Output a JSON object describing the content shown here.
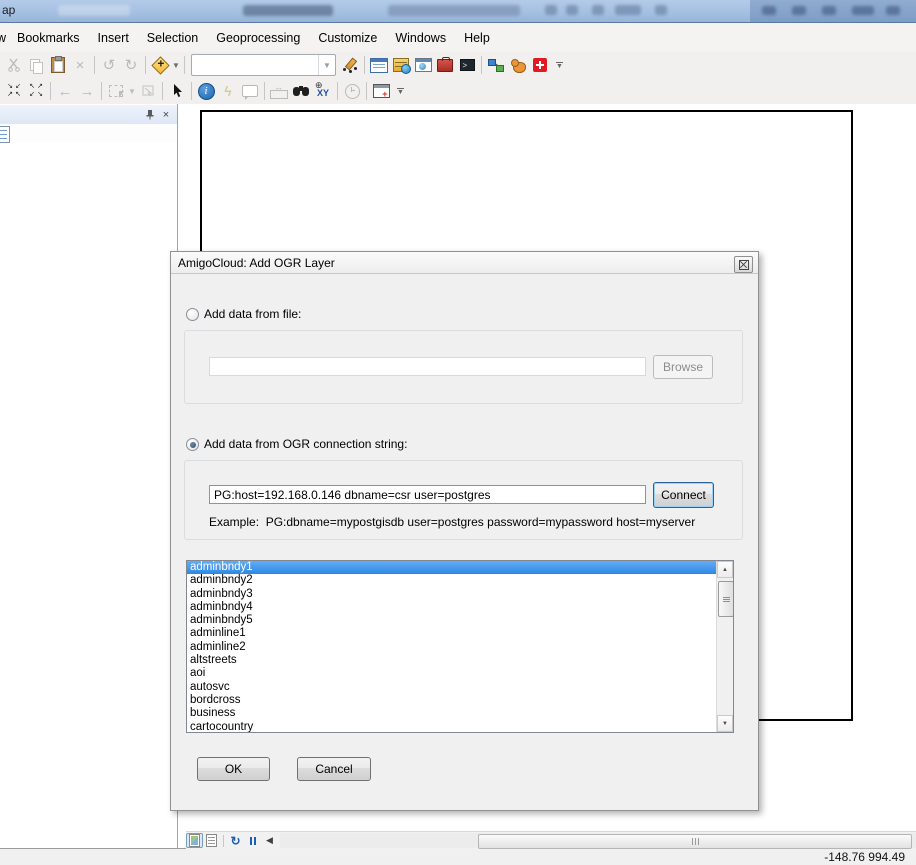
{
  "window": {
    "titlebar_fragment": "ap"
  },
  "menubar": {
    "items": [
      "w",
      "Bookmarks",
      "Insert",
      "Selection",
      "Geoprocessing",
      "Customize",
      "Windows",
      "Help"
    ]
  },
  "toolbars": {
    "standard_icons": [
      "cut",
      "copy",
      "paste",
      "delete",
      "undo",
      "redo",
      "add-data",
      "scale-combo",
      "edit-sketch",
      "table-of-contents",
      "catalog",
      "search-window",
      "arctoolbox",
      "python-window",
      "model-builder",
      "mascot",
      "amigocloud",
      "toolbar-overflow"
    ],
    "tools_icons": [
      "fixed-zoom-in",
      "fixed-zoom-out",
      "go-back",
      "go-forward",
      "select-features",
      "clear-selection",
      "select-elements",
      "identify",
      "hyperlink",
      "html-popup",
      "measure",
      "find",
      "go-to-xy",
      "time-slider",
      "viewer-window",
      "toolbar-overflow"
    ]
  },
  "dialog": {
    "title": "AmigoCloud: Add OGR Layer",
    "file_radio_label": "Add data from file:",
    "file_path_value": "",
    "browse_button": "Browse",
    "ogr_radio_label": "Add data from OGR connection string:",
    "connection_string": "PG:host=192.168.0.146 dbname=csr user=postgres",
    "connect_button": "Connect",
    "example_text": "Example:  PG:dbname=mypostgisdb user=postgres password=mypassword host=myserver",
    "layers": [
      "adminbndy1",
      "adminbndy2",
      "adminbndy3",
      "adminbndy4",
      "adminbndy5",
      "adminline1",
      "adminline2",
      "altstreets",
      "aoi",
      "autosvc",
      "bordcross",
      "business",
      "cartocountry"
    ],
    "selected_layer": "adminbndy1",
    "ok_button": "OK",
    "cancel_button": "Cancel"
  },
  "statusbar": {
    "coordinates": "-148.76  994.49"
  },
  "colors": {
    "selection_blue": "#3d9bef",
    "amigocloud_red": "#e01b24",
    "titlebar_blue": "#a9c3e2",
    "dialog_bg": "#f0f0f0"
  }
}
